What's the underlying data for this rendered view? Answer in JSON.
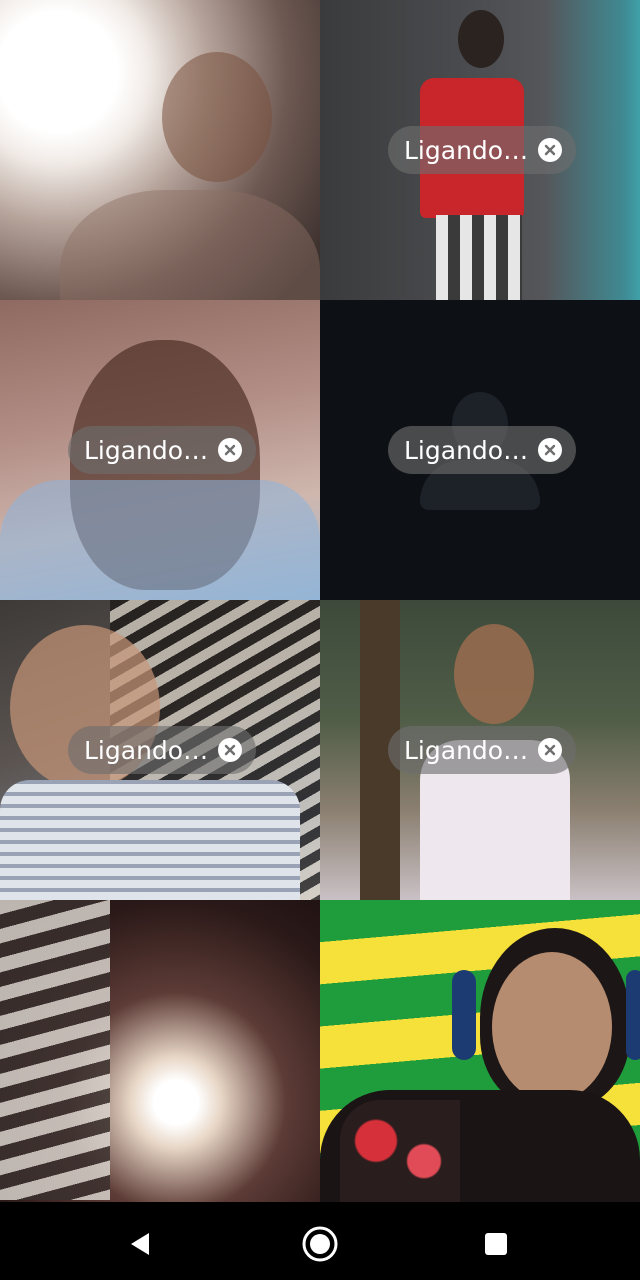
{
  "call": {
    "status_label": "Ligando…",
    "tiles": [
      {
        "id": "participant-1",
        "connecting": false
      },
      {
        "id": "participant-2",
        "connecting": true
      },
      {
        "id": "participant-3",
        "connecting": true
      },
      {
        "id": "participant-4",
        "connecting": true,
        "video": false
      },
      {
        "id": "participant-5",
        "connecting": true
      },
      {
        "id": "participant-6",
        "connecting": true
      },
      {
        "id": "participant-7",
        "connecting": false
      },
      {
        "id": "participant-8",
        "connecting": false
      }
    ]
  },
  "icons": {
    "cancel": "close-icon",
    "avatar": "person-placeholder-icon",
    "nav_back": "back-triangle-icon",
    "nav_home": "home-circle-icon",
    "nav_recents": "recents-square-icon"
  },
  "colors": {
    "pill_bg": "#6e6e6e",
    "pill_text": "#ffffff",
    "nav_bg": "#000000",
    "nav_icon": "#ffffff"
  }
}
